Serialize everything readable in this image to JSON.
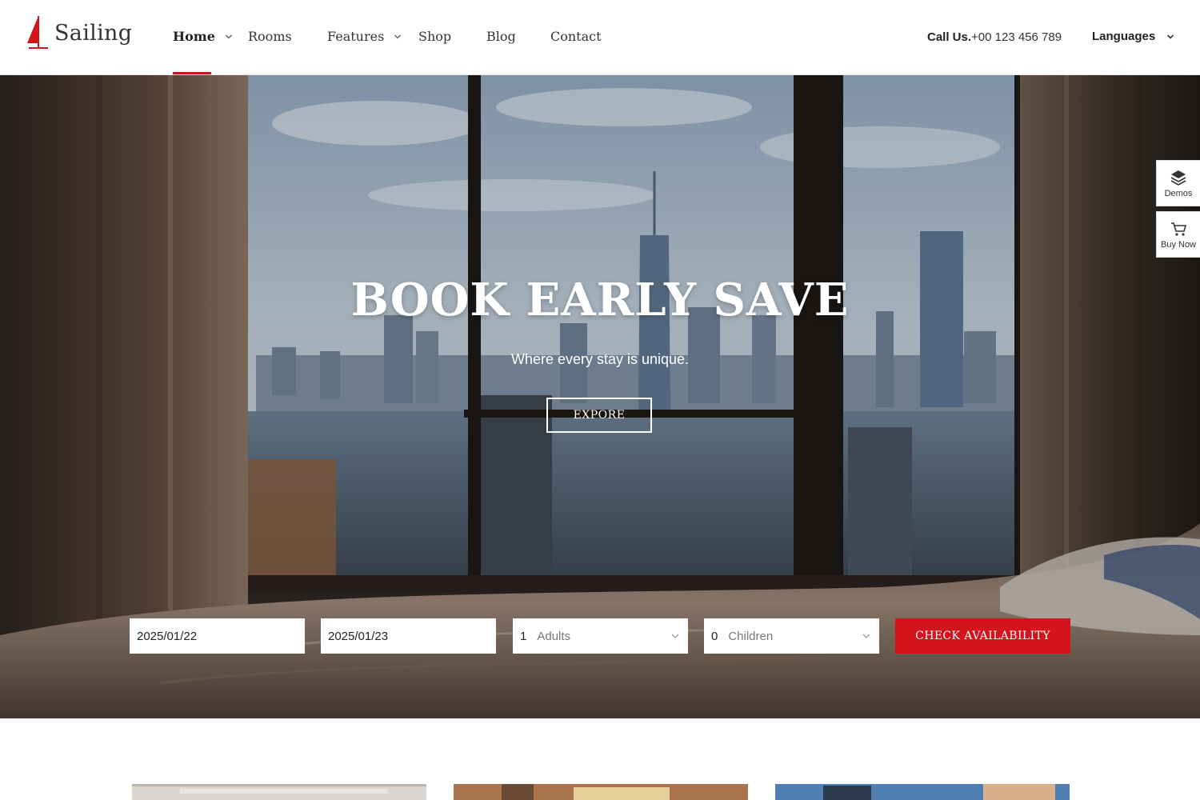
{
  "brand": {
    "name": "Sailing",
    "accent": "#d4141c"
  },
  "nav": {
    "items": [
      {
        "label": "Home",
        "active": true,
        "has_dropdown": true
      },
      {
        "label": "Rooms",
        "active": false,
        "has_dropdown": false
      },
      {
        "label": "Features",
        "active": false,
        "has_dropdown": true
      },
      {
        "label": "Shop",
        "active": false,
        "has_dropdown": false
      },
      {
        "label": "Blog",
        "active": false,
        "has_dropdown": false
      },
      {
        "label": "Contact",
        "active": false,
        "has_dropdown": false
      }
    ]
  },
  "contact": {
    "call_label": "Call Us.",
    "phone": "+00 123 456 789"
  },
  "languages": {
    "label": "Languages"
  },
  "hero": {
    "title": "BOOK EARLY SAVE",
    "subtitle": "Where every stay is unique.",
    "button_label": "EXPORE"
  },
  "booking": {
    "check_in": "2025/01/22",
    "check_out": "2025/01/23",
    "adults": {
      "value": "1",
      "label": "Adults"
    },
    "children": {
      "value": "0",
      "label": "Children"
    },
    "submit_label": "CHECK AVAILABILITY"
  },
  "side_widgets": {
    "demos_label": "Demos",
    "buy_label": "Buy Now"
  },
  "icons": [
    "sail-logo-icon",
    "chevron-down-icon",
    "layers-icon",
    "cart-icon"
  ]
}
